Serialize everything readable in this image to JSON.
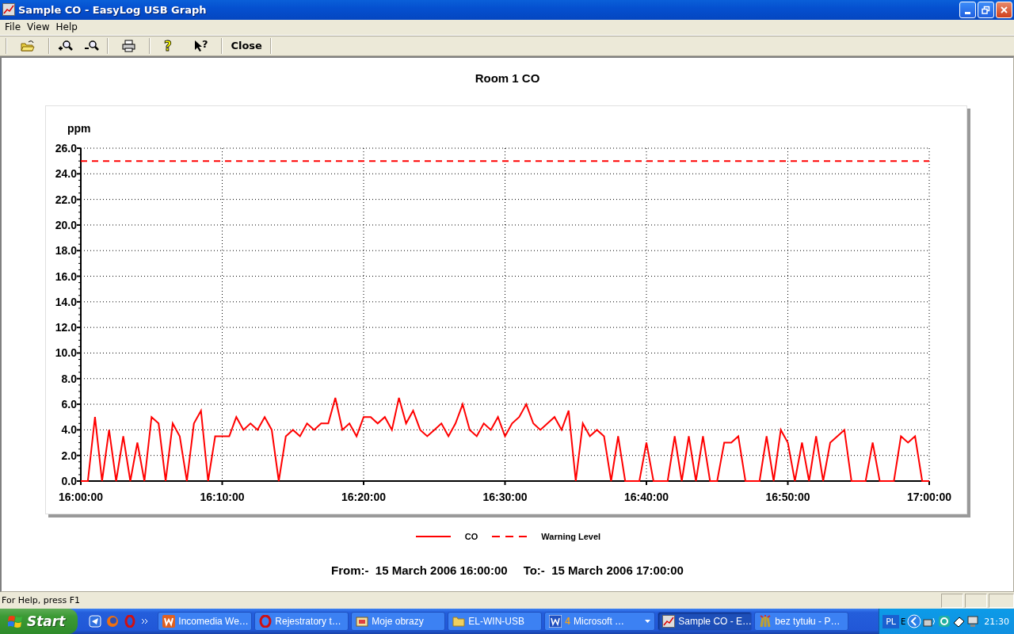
{
  "window": {
    "title": "Sample CO - EasyLog USB Graph"
  },
  "menu": [
    {
      "label": "File"
    },
    {
      "label": "View"
    },
    {
      "label": "Help"
    }
  ],
  "toolbar": {
    "help_symbol": "?",
    "context_help_symbol": "?",
    "close_label": "Close"
  },
  "graph": {
    "title": "Room 1 CO",
    "chart_data": {
      "type": "line",
      "ylabel": "ppm",
      "categories": [
        "16:00:00",
        null,
        null,
        null,
        null,
        null,
        null,
        null,
        null,
        null,
        null,
        null,
        null,
        null,
        null,
        null,
        null,
        null,
        null,
        null,
        "16:10:00",
        null,
        null,
        null,
        null,
        null,
        null,
        null,
        null,
        null,
        null,
        null,
        null,
        null,
        null,
        null,
        null,
        null,
        null,
        null,
        "16:20:00",
        null,
        null,
        null,
        null,
        null,
        null,
        null,
        null,
        null,
        null,
        null,
        null,
        null,
        null,
        null,
        null,
        null,
        null,
        null,
        "16:30:00",
        null,
        null,
        null,
        null,
        null,
        null,
        null,
        null,
        null,
        null,
        null,
        null,
        null,
        null,
        null,
        null,
        null,
        null,
        null,
        "16:40:00",
        null,
        null,
        null,
        null,
        null,
        null,
        null,
        null,
        null,
        null,
        null,
        null,
        null,
        null,
        null,
        null,
        null,
        null,
        null,
        "16:50:00",
        null,
        null,
        null,
        null,
        null,
        null,
        null,
        null,
        null,
        null,
        null,
        null,
        null,
        null,
        null,
        null,
        null,
        null,
        null,
        "17:00:00"
      ],
      "series": [
        {
          "name": "CO",
          "color": "#ff0000",
          "values": [
            0,
            0,
            5,
            0,
            4,
            0,
            3.5,
            0,
            3,
            0,
            5,
            4.5,
            0,
            4.5,
            3.5,
            0,
            4.5,
            5.5,
            0,
            3.5,
            3.5,
            3.5,
            5,
            4,
            4.5,
            4,
            5,
            4,
            0,
            3.5,
            4,
            3.5,
            4.5,
            4,
            4.5,
            4.5,
            6.5,
            4,
            4.5,
            3.5,
            5,
            5,
            4.5,
            5,
            4,
            6.5,
            4.5,
            5.5,
            4,
            3.5,
            4,
            4.5,
            3.5,
            4.5,
            6,
            4,
            3.5,
            4.5,
            4,
            5,
            3.5,
            4.5,
            5,
            6,
            4.5,
            4,
            4.5,
            5,
            4,
            5.5,
            0,
            4.5,
            3.5,
            4,
            3.5,
            0,
            3.5,
            0,
            0,
            0,
            3,
            0,
            0,
            0,
            3.5,
            0,
            3.5,
            0,
            3.5,
            0,
            0,
            3,
            3,
            3.5,
            0,
            0,
            0,
            3.5,
            0,
            4,
            3,
            0,
            3,
            0,
            3.5,
            0,
            3,
            3.5,
            4,
            0,
            0,
            0,
            3,
            0,
            0,
            0,
            3.5,
            3,
            3.5,
            0,
            0
          ]
        }
      ],
      "ref_lines": [
        {
          "axis": "y",
          "value": 25,
          "label": "Warning Level",
          "color": "#ff0000"
        }
      ],
      "ylim": [
        0,
        26
      ],
      "grid": true,
      "yticks": [
        {
          "value": 0,
          "label": "0.0"
        },
        {
          "value": 2,
          "label": "2.0"
        },
        {
          "value": 4,
          "label": "4.0"
        },
        {
          "value": 6,
          "label": "6.0"
        },
        {
          "value": 8,
          "label": "8.0"
        },
        {
          "value": 10,
          "label": "10.0"
        },
        {
          "value": 12,
          "label": "12.0"
        },
        {
          "value": 14,
          "label": "14.0"
        },
        {
          "value": 16,
          "label": "16.0"
        },
        {
          "value": 18,
          "label": "18.0"
        },
        {
          "value": 20,
          "label": "20.0"
        },
        {
          "value": 22,
          "label": "22.0"
        },
        {
          "value": 24,
          "label": "24.0"
        },
        {
          "value": 26,
          "label": "26.0"
        }
      ]
    },
    "from_text": "From:-  15 March 2006 16:00:00",
    "to_text": "To:-  15 March 2006 17:00:00"
  },
  "status_bar": {
    "text": "For Help, press F1"
  },
  "taskbar": {
    "start_label": "Start",
    "tasks": [
      {
        "kind": "web",
        "label": "Incomedia We…",
        "selected": false
      },
      {
        "kind": "browser",
        "label": "Rejestratory t…",
        "selected": false
      },
      {
        "kind": "images",
        "label": "Moje obrazy",
        "selected": false
      },
      {
        "kind": "folder",
        "label": "EL-WIN-USB",
        "selected": false
      },
      {
        "kind": "word",
        "count": "4",
        "label": "Microsoft …",
        "selected": false
      },
      {
        "kind": "graph",
        "label": "Sample CO - E…",
        "selected": true
      },
      {
        "kind": "paint",
        "label": "bez tytułu - P…",
        "selected": false
      }
    ],
    "language": "PL",
    "tray_letter": "E",
    "clock": "21:30"
  }
}
